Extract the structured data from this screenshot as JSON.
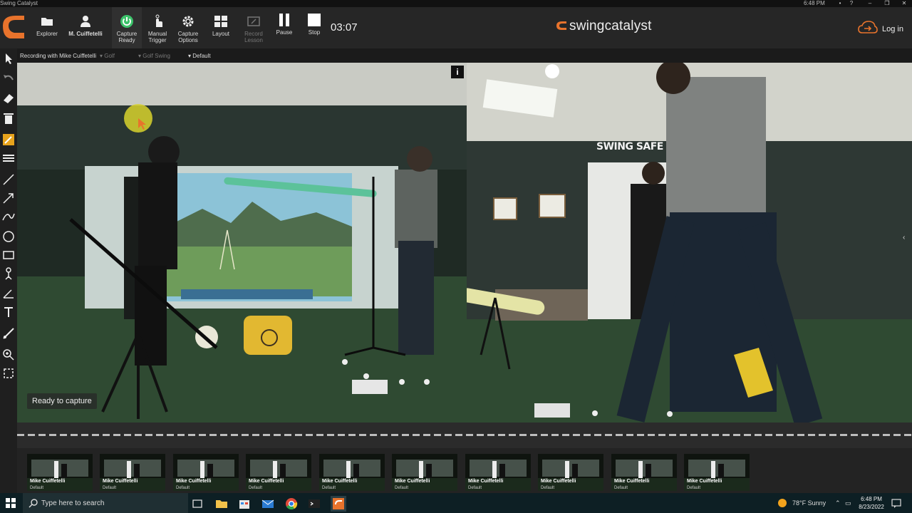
{
  "window": {
    "title": "Swing Catalyst",
    "clock": "6:48 PM",
    "buttons": [
      "?",
      "–",
      "❐",
      "✕"
    ]
  },
  "toolbar": {
    "explorer": "Explorer",
    "user": "M. Cuiffetelli",
    "capture_ready": [
      "Capture",
      "Ready"
    ],
    "manual_trigger": [
      "Manual",
      "Trigger"
    ],
    "capture_options": [
      "Capture",
      "Options"
    ],
    "layout": "Layout",
    "record_lesson": [
      "Record",
      "Lesson"
    ],
    "pause": "Pause",
    "stop": "Stop",
    "timer": "03:07",
    "brand": "swingcatalyst",
    "login": "Log in",
    "colors": {
      "accent": "#e8732c",
      "ready": "#3cc26a"
    }
  },
  "session": {
    "recording": "Recording with  Mike Cuiffetelli",
    "sport": "Golf",
    "activity": "Golf Swing",
    "preset": "Default"
  },
  "video": {
    "status": "Ready to capture",
    "info": "i",
    "sign": "SWING SAFE"
  },
  "clips": [
    {
      "name": "Mike Cuiffetelli",
      "sub": "Default"
    },
    {
      "name": "Mike Cuiffetelli",
      "sub": "Default"
    },
    {
      "name": "Mike Cuiffetelli",
      "sub": "Default"
    },
    {
      "name": "Mike Cuiffetelli",
      "sub": "Default"
    },
    {
      "name": "Mike Cuiffetelli",
      "sub": "Default"
    },
    {
      "name": "Mike Cuiffetelli",
      "sub": "Default"
    },
    {
      "name": "Mike Cuiffetelli",
      "sub": "Default"
    },
    {
      "name": "Mike Cuiffetelli",
      "sub": "Default"
    },
    {
      "name": "Mike Cuiffetelli",
      "sub": "Default"
    },
    {
      "name": "Mike Cuiffetelli",
      "sub": "Default"
    }
  ],
  "taskbar": {
    "search_placeholder": "Type here to search",
    "weather": "78°F  Sunny",
    "time": "6:48 PM",
    "date": "8/23/2022"
  }
}
